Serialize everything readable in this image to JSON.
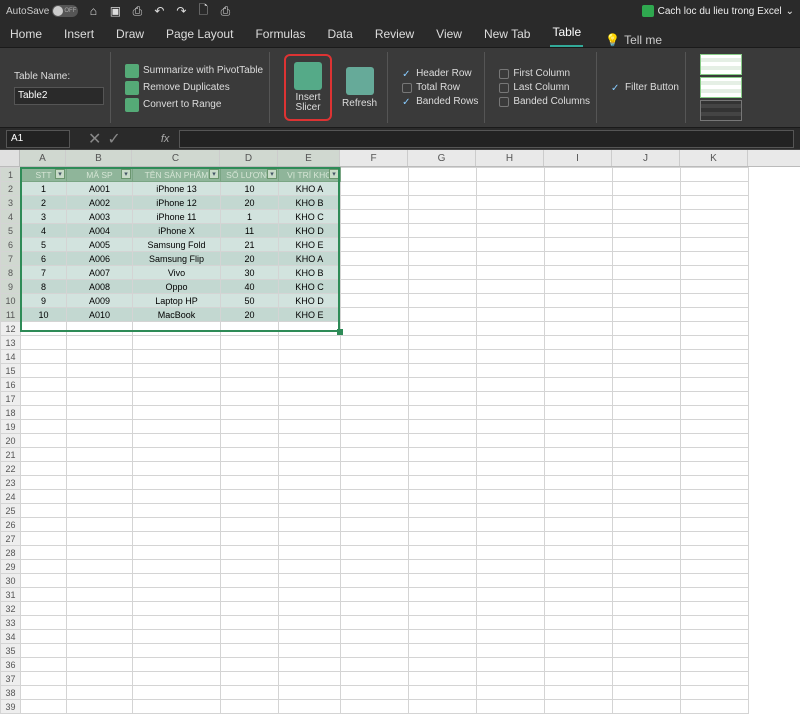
{
  "title": {
    "autosave": "AutoSave",
    "toggle": "OFF",
    "filename": "Cach loc du lieu trong Excel"
  },
  "tabs": [
    "Home",
    "Insert",
    "Draw",
    "Page Layout",
    "Formulas",
    "Data",
    "Review",
    "View",
    "New Tab",
    "Table"
  ],
  "active_tab": "Table",
  "tellme": "Tell me",
  "ribbon": {
    "tablename_label": "Table Name:",
    "tablename_value": "Table2",
    "tools": {
      "pivot": "Summarize with PivotTable",
      "dup": "Remove Duplicates",
      "range": "Convert to Range"
    },
    "insert_slicer": "Insert\nSlicer",
    "refresh": "Refresh",
    "opts": {
      "header_row": "Header Row",
      "total_row": "Total Row",
      "banded_rows": "Banded Rows",
      "first_col": "First Column",
      "last_col": "Last Column",
      "banded_cols": "Banded Columns",
      "filter_btn": "Filter Button"
    }
  },
  "namebox": "A1",
  "columns": [
    "A",
    "B",
    "C",
    "D",
    "E",
    "F",
    "G",
    "H",
    "I",
    "J",
    "K"
  ],
  "table_headers": [
    "STT",
    "MÃ SP",
    "TÊN SẢN PHẨM",
    "SỐ LƯỢNG",
    "VỊ TRÍ KHO"
  ],
  "rows": [
    [
      "1",
      "A001",
      "iPhone 13",
      "10",
      "KHO A"
    ],
    [
      "2",
      "A002",
      "iPhone 12",
      "20",
      "KHO B"
    ],
    [
      "3",
      "A003",
      "iPhone 11",
      "1",
      "KHO C"
    ],
    [
      "4",
      "A004",
      "iPhone X",
      "11",
      "KHO D"
    ],
    [
      "5",
      "A005",
      "Samsung Fold",
      "21",
      "KHO E"
    ],
    [
      "6",
      "A006",
      "Samsung Flip",
      "20",
      "KHO A"
    ],
    [
      "7",
      "A007",
      "Vivo",
      "30",
      "KHO B"
    ],
    [
      "8",
      "A008",
      "Oppo",
      "40",
      "KHO C"
    ],
    [
      "9",
      "A009",
      "Laptop HP",
      "50",
      "KHO D"
    ],
    [
      "10",
      "A010",
      "MacBook",
      "20",
      "KHO E"
    ]
  ],
  "empty_rows": 28
}
